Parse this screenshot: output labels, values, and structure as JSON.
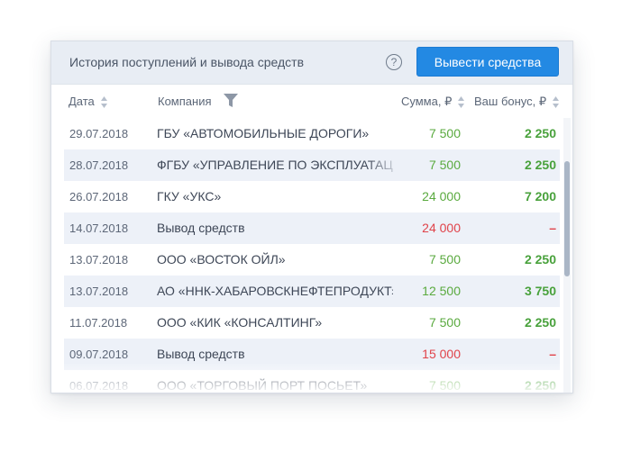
{
  "header": {
    "title": "История поступлений и вывода средств",
    "help_glyph": "?",
    "withdraw_label": "Вывести средства"
  },
  "columns": {
    "date": "Дата",
    "company": "Компания",
    "sum": "Сумма, ₽",
    "bonus": "Ваш бонус, ₽"
  },
  "rows": [
    {
      "date": "29.07.2018",
      "company": "ГБУ «АВТОМОБИЛЬНЫЕ ДОРОГИ»",
      "sum": "7 500",
      "bonus": "2 250",
      "type": "income"
    },
    {
      "date": "28.07.2018",
      "company": "ФГБУ «УПРАВЛЕНИЕ ПО ЭКСПЛУАТАЦИ",
      "sum": "7 500",
      "bonus": "2 250",
      "type": "income"
    },
    {
      "date": "26.07.2018",
      "company": "ГКУ «УКС»",
      "sum": "24 000",
      "bonus": "7 200",
      "type": "income"
    },
    {
      "date": "14.07.2018",
      "company": "Вывод средств",
      "sum": "24 000",
      "bonus": "–",
      "type": "withdrawal"
    },
    {
      "date": "13.07.2018",
      "company": "ООО «ВОСТОК ОЙЛ»",
      "sum": "7 500",
      "bonus": "2 250",
      "type": "income"
    },
    {
      "date": "13.07.2018",
      "company": "АО «ННК-ХАБАРОВСКНЕФТЕПРОДУКТ»",
      "sum": "12 500",
      "bonus": "3 750",
      "type": "income"
    },
    {
      "date": "11.07.2018",
      "company": "ООО «КИК «КОНСАЛТИНГ»",
      "sum": "7 500",
      "bonus": "2 250",
      "type": "income"
    },
    {
      "date": "09.07.2018",
      "company": "Вывод средств",
      "sum": "15 000",
      "bonus": "–",
      "type": "withdrawal"
    },
    {
      "date": "06.07.2018",
      "company": "ООО «ТОРГОВЫЙ ПОРТ ПОСЬЕТ»",
      "sum": "7 500",
      "bonus": "2 250",
      "type": "income"
    }
  ],
  "icons": {
    "help": "question-circle-icon",
    "filter": "funnel-filter-icon",
    "sort": "sort-arrows-icon"
  },
  "colors": {
    "accent": "#2389e3",
    "income": "#5aaa3f",
    "withdrawal": "#e0434a",
    "header_bg": "#e8edf4",
    "row_alt_bg": "#edf1f8"
  }
}
